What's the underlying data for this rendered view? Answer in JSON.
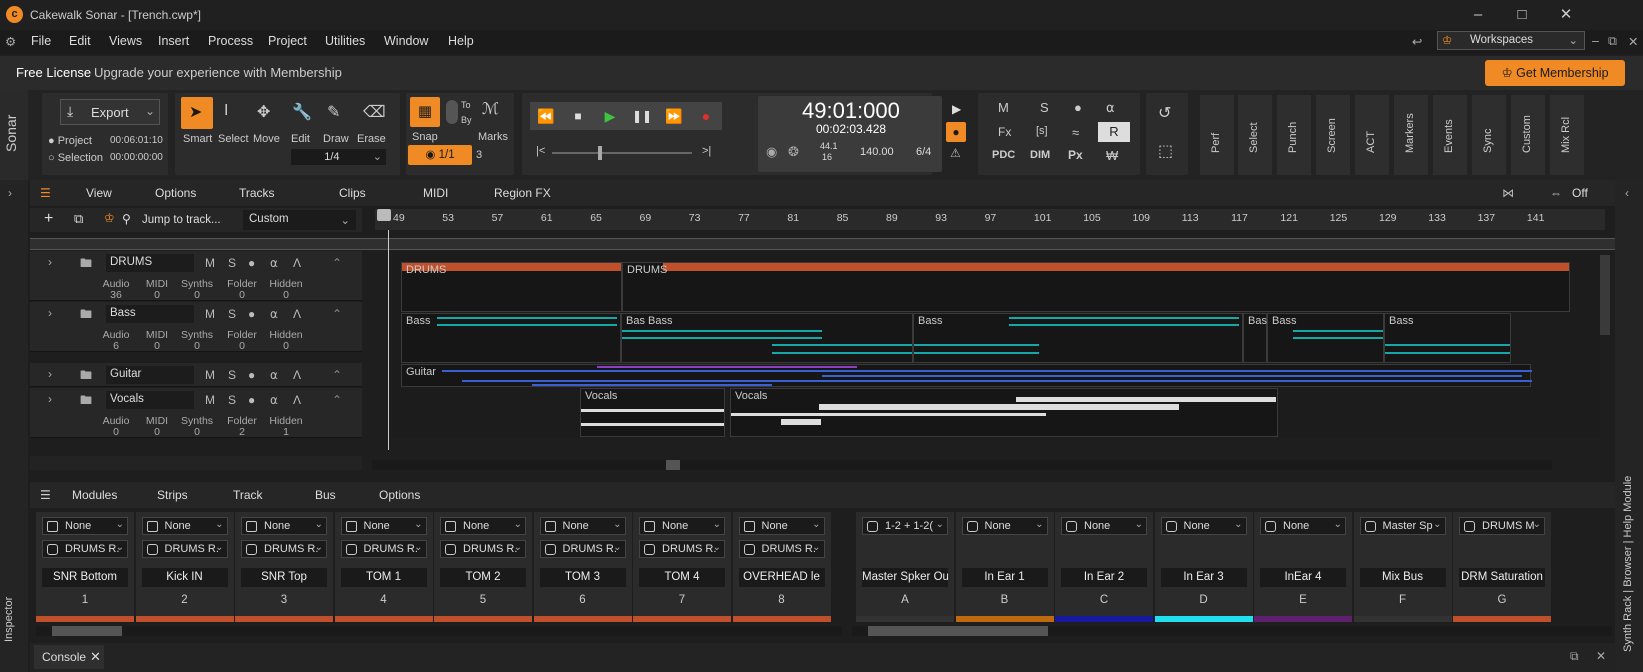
{
  "window": {
    "title": "Cakewalk Sonar - [Trench.cwp*]"
  },
  "menu": [
    "File",
    "Edit",
    "Views",
    "Insert",
    "Process",
    "Project",
    "Utilities",
    "Window",
    "Help"
  ],
  "workspaces": {
    "label": "Workspaces"
  },
  "license": {
    "label": "Free License",
    "message": "Upgrade your experience with Membership",
    "button": "Get Membership"
  },
  "brand": {
    "name": "Sonar"
  },
  "export": {
    "label": "Export",
    "project": "Project",
    "project_time": "00:06:01:10",
    "selection": "Selection",
    "selection_time": "00:00:00:00"
  },
  "tools": [
    {
      "label": "Smart",
      "icon": "arrow-icon"
    },
    {
      "label": "Select",
      "icon": "ibeam-icon"
    },
    {
      "label": "Move",
      "icon": "move-icon"
    },
    {
      "label": "Edit",
      "icon": "wrench-icon"
    },
    {
      "label": "Draw",
      "icon": "pencil-icon"
    },
    {
      "label": "Erase",
      "icon": "eraser-icon"
    }
  ],
  "tool_resolution": "1/4",
  "snap": {
    "label": "Snap",
    "to": "To",
    "by": "By",
    "value": "1/1",
    "marks": "Marks",
    "marks_count": "3"
  },
  "transport": {
    "time": "49:01:000",
    "clock": "00:02:03.428",
    "sample_rate_top": "44.1",
    "sample_rate_bottom": "16",
    "tempo": "140.00",
    "meter": "6/4"
  },
  "mix_buttons": {
    "m": "M",
    "s": "S",
    "r": "R",
    "pdc": "PDC",
    "dim": "DIM",
    "px": "Px",
    "fx": "Fx",
    "bracket_s": "[s]"
  },
  "side_modules": [
    "Perf",
    "Select",
    "Punch",
    "Screen",
    "ACT",
    "Markers",
    "Events",
    "Sync",
    "Custom",
    "Mix Rcl"
  ],
  "track_menu": [
    "View",
    "Options",
    "Tracks",
    "Clips",
    "MIDI",
    "Region FX"
  ],
  "snap_off": "Off",
  "jump": {
    "label": "Jump to track...",
    "preset": "Custom"
  },
  "ruler": [
    "49",
    "53",
    "57",
    "61",
    "65",
    "69",
    "73",
    "77",
    "81",
    "85",
    "89",
    "93",
    "97",
    "101",
    "105",
    "109",
    "113",
    "117",
    "121",
    "125",
    "129",
    "133",
    "137",
    "141"
  ],
  "tracks": [
    {
      "name": "DRUMS",
      "sub": [
        {
          "k": "Audio",
          "v": "36"
        },
        {
          "k": "MIDI",
          "v": "0"
        },
        {
          "k": "Synths",
          "v": "0"
        },
        {
          "k": "Folder",
          "v": "0"
        },
        {
          "k": "Hidden",
          "v": "0"
        }
      ]
    },
    {
      "name": "Bass",
      "sub": [
        {
          "k": "Audio",
          "v": "6"
        },
        {
          "k": "MIDI",
          "v": "0"
        },
        {
          "k": "Synths",
          "v": "0"
        },
        {
          "k": "Folder",
          "v": "0"
        },
        {
          "k": "Hidden",
          "v": "0"
        }
      ]
    },
    {
      "name": "Guitar",
      "sub": []
    },
    {
      "name": "Vocals",
      "sub": [
        {
          "k": "Audio",
          "v": "0"
        },
        {
          "k": "MIDI",
          "v": "0"
        },
        {
          "k": "Synths",
          "v": "0"
        },
        {
          "k": "Folder",
          "v": "2"
        },
        {
          "k": "Hidden",
          "v": "1"
        }
      ]
    }
  ],
  "track_buttons": {
    "m": "M",
    "s": "S"
  },
  "clip_names": {
    "drums": "DRUMS",
    "bass": "Bass",
    "bass_short": "Bas",
    "guitar": "Guitar",
    "vocals": "Vocals"
  },
  "console_menu": [
    "Modules",
    "Strips",
    "Track",
    "Bus",
    "Options"
  ],
  "strips": [
    {
      "in": "None",
      "out": "DRUMS R.",
      "name": "SNR Bottom",
      "num": "1",
      "color": "#c0502b"
    },
    {
      "in": "None",
      "out": "DRUMS R.",
      "name": "Kick IN",
      "num": "2",
      "color": "#c0502b"
    },
    {
      "in": "None",
      "out": "DRUMS R.",
      "name": "SNR Top",
      "num": "3",
      "color": "#c0502b"
    },
    {
      "in": "None",
      "out": "DRUMS R.",
      "name": "TOM 1",
      "num": "4",
      "color": "#c0502b"
    },
    {
      "in": "None",
      "out": "DRUMS R.",
      "name": "TOM 2",
      "num": "5",
      "color": "#c0502b"
    },
    {
      "in": "None",
      "out": "DRUMS R.",
      "name": "TOM 3",
      "num": "6",
      "color": "#c0502b"
    },
    {
      "in": "None",
      "out": "DRUMS R.",
      "name": "TOM 4",
      "num": "7",
      "color": "#c0502b"
    },
    {
      "in": "None",
      "out": "DRUMS R.",
      "name": "OVERHEAD le",
      "num": "8",
      "color": "#c0502b"
    }
  ],
  "buses": [
    {
      "out": "1-2 + 1-2(",
      "name": "Master Spker Out",
      "num": "A",
      "color": "#333333"
    },
    {
      "out": "None",
      "name": "In Ear 1",
      "num": "B",
      "color": "#c06a10"
    },
    {
      "out": "None",
      "name": "In Ear 2",
      "num": "C",
      "color": "#1818a0"
    },
    {
      "out": "None",
      "name": "In Ear 3",
      "num": "D",
      "color": "#20e0f0"
    },
    {
      "out": "None",
      "name": "InEar 4",
      "num": "E",
      "color": "#602070"
    },
    {
      "out": "Master Sp",
      "name": "Mix Bus",
      "num": "F",
      "color": "#333333"
    },
    {
      "out": "DRUMS M",
      "name": "DRM Saturation",
      "num": "G",
      "color": "#c0502b"
    }
  ],
  "inspector": "Inspector",
  "console_tab": "Console",
  "right_dock": "Synth Rack | Browser | Help Module"
}
